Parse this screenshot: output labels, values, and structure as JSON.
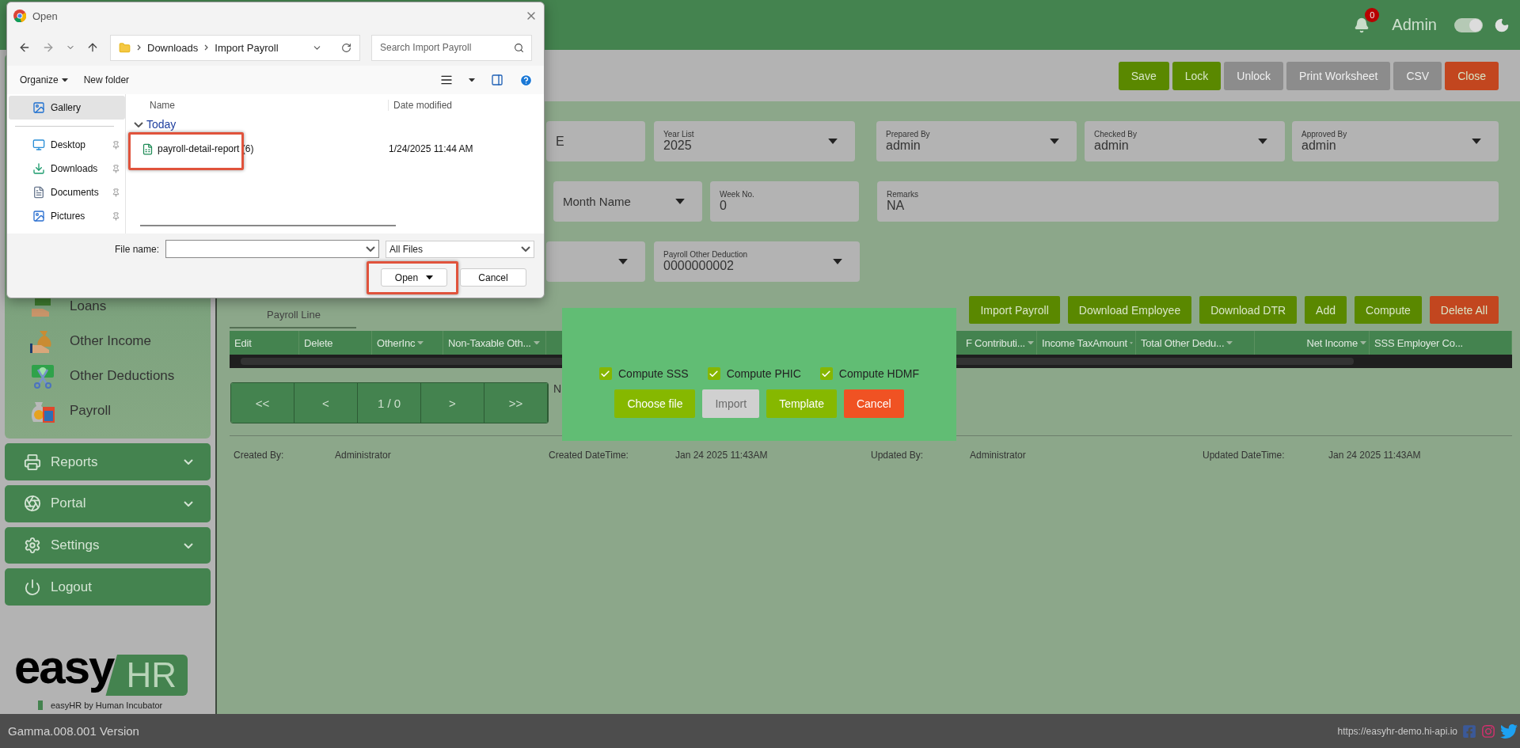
{
  "header": {
    "notifications": "0",
    "user": "Admin",
    "theme_toggle_on": true
  },
  "sidebar": {
    "items": [
      {
        "label": "Loans",
        "kind": "loans"
      },
      {
        "label": "Other Income",
        "kind": "income"
      },
      {
        "label": "Other Deductions",
        "kind": "deductions"
      },
      {
        "label": "Payroll",
        "kind": "payroll"
      }
    ],
    "sections": [
      {
        "label": "Reports",
        "kind": "reports",
        "expandable": true
      },
      {
        "label": "Portal",
        "kind": "portal",
        "expandable": true
      },
      {
        "label": "Settings",
        "kind": "settings",
        "expandable": true
      },
      {
        "label": "Logout",
        "kind": "logout",
        "expandable": false
      }
    ],
    "logo": {
      "word": "easy",
      "badge": "HR",
      "tagline": "easyHR by Human Incubator"
    }
  },
  "toolbar_buttons": [
    {
      "label": "Save",
      "kind": "primary",
      "disabled": false
    },
    {
      "label": "Lock",
      "kind": "primary",
      "disabled": false
    },
    {
      "label": "Unlock",
      "kind": "primary",
      "disabled": true
    },
    {
      "label": "Print Worksheet",
      "kind": "primary",
      "disabled": true
    },
    {
      "label": "CSV",
      "kind": "primary",
      "disabled": true
    },
    {
      "label": "Close",
      "kind": "danger",
      "disabled": false
    }
  ],
  "form_rows": [
    [
      {
        "kind": "text",
        "value": "E"
      },
      {
        "kind": "select",
        "label": "Year List",
        "value": "2025"
      },
      {
        "kind": "select",
        "label": "Prepared By",
        "value": "admin"
      },
      {
        "kind": "select",
        "label": "Checked By",
        "value": "admin"
      },
      {
        "kind": "select",
        "label": "Approved By",
        "value": "admin"
      }
    ],
    [
      {
        "kind": "select",
        "placeholder": "Month Name"
      },
      {
        "kind": "text",
        "label": "Week No.",
        "value": "0"
      },
      {
        "kind": "text",
        "label": "Remarks",
        "value": "NA"
      }
    ],
    [
      {
        "kind": "select"
      },
      {
        "kind": "select",
        "label": "Payroll Other Deduction",
        "value": "0000000002"
      }
    ]
  ],
  "tabs": [
    {
      "label": "Payroll Line",
      "selected": true
    }
  ],
  "line_buttons": [
    {
      "label": "Import Payroll",
      "kind": "primary"
    },
    {
      "label": "Download Employee",
      "kind": "primary"
    },
    {
      "label": "Download DTR",
      "kind": "primary"
    },
    {
      "label": "Add",
      "kind": "primary"
    },
    {
      "label": "Compute",
      "kind": "primary"
    },
    {
      "label": "Delete All",
      "kind": "danger"
    }
  ],
  "table": {
    "columns": [
      {
        "label": "Edit",
        "filter": false
      },
      {
        "label": "Delete",
        "filter": false
      },
      {
        "label": "OtherInc",
        "filter": true
      },
      {
        "label": "Non-Taxable Oth...",
        "filter": true
      },
      {
        "label": "F Contributi...",
        "filter": true
      },
      {
        "label": "Income TaxAmount",
        "filter": true
      },
      {
        "label": "Total Other Dedu...",
        "filter": true
      },
      {
        "label": "Net Income",
        "filter": true
      },
      {
        "label": "SSS Employer Co...",
        "filter": false
      }
    ]
  },
  "pager": [
    "<<",
    "<",
    "1 / 0",
    ">",
    ">>"
  ],
  "pager_note": "N",
  "audit": [
    {
      "label": "Created By:",
      "value": "Administrator"
    },
    {
      "label": "Created DateTime:",
      "value": "Jan 24 2025 11:43AM"
    },
    {
      "label": "Updated By:",
      "value": "Administrator"
    },
    {
      "label": "Updated DateTime:",
      "value": "Jan 24 2025 11:43AM"
    }
  ],
  "import_modal": {
    "options": [
      {
        "label": "Compute SSS",
        "checked": true
      },
      {
        "label": "Compute PHIC",
        "checked": true
      },
      {
        "label": "Compute HDMF",
        "checked": true
      }
    ],
    "buttons": [
      {
        "label": "Choose file",
        "kind": "primary",
        "disabled": false
      },
      {
        "label": "Import",
        "kind": "primary",
        "disabled": true
      },
      {
        "label": "Template",
        "kind": "primary",
        "disabled": false
      },
      {
        "label": "Cancel",
        "kind": "danger",
        "disabled": false
      }
    ]
  },
  "file_dialog": {
    "title": "Open",
    "breadcrumb": [
      "Downloads",
      "Import Payroll"
    ],
    "search": {
      "placeholder": "Search Import Payroll"
    },
    "toolbar": [
      "Organize",
      "New folder"
    ],
    "nav_items": [
      {
        "label": "Gallery",
        "kind": "gallery",
        "selected": true
      },
      {
        "label": "Desktop",
        "kind": "desktop",
        "selected": false
      },
      {
        "label": "Downloads",
        "kind": "downloads",
        "selected": false
      },
      {
        "label": "Documents",
        "kind": "documents",
        "selected": false
      },
      {
        "label": "Pictures",
        "kind": "pictures",
        "selected": false
      }
    ],
    "columns": [
      "Name",
      "Date modified"
    ],
    "group": "Today",
    "files": [
      {
        "name": "payroll-detail-report (6)",
        "date": "1/24/2025 11:44 AM",
        "highlighted": true
      }
    ],
    "file_name_label": "File name:",
    "file_type": "All Files",
    "buttons": [
      {
        "label": "Open",
        "kind": "split",
        "highlighted": true
      },
      {
        "label": "Cancel",
        "kind": "plain",
        "highlighted": false
      }
    ]
  },
  "footer": {
    "version": "Gamma.008.001 Version",
    "url": "https://easyhr-demo.hi-api.io"
  }
}
